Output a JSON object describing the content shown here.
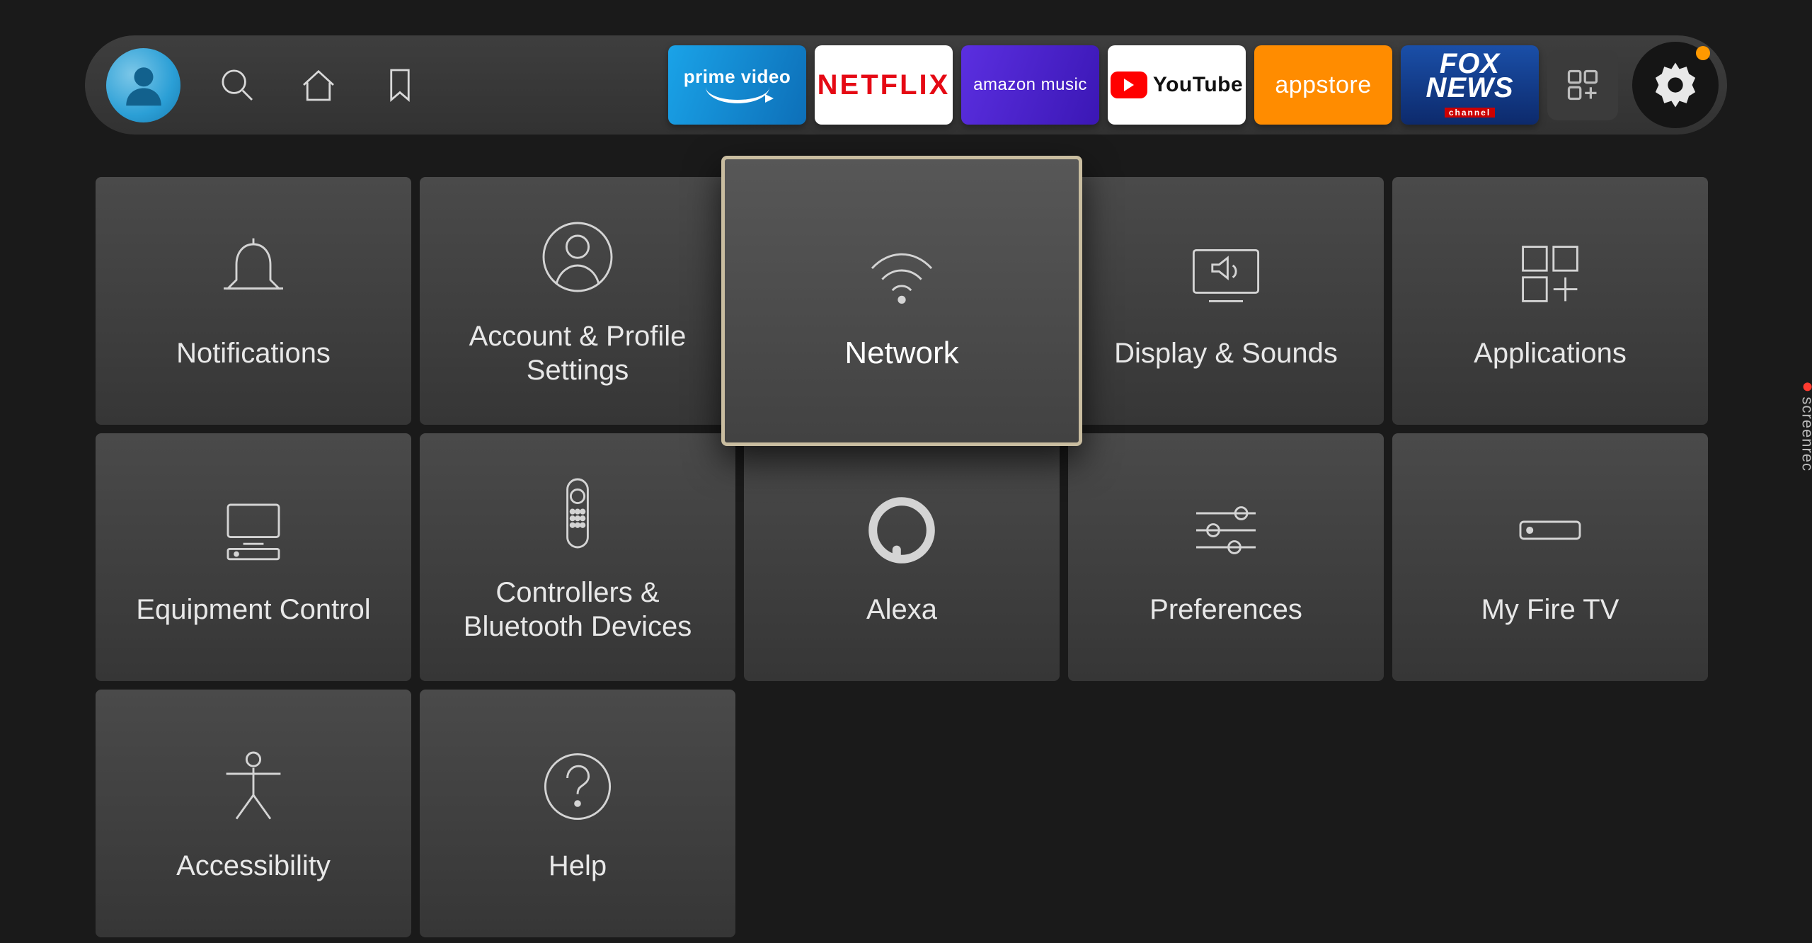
{
  "top_nav": {
    "apps": [
      {
        "id": "prime-video",
        "label": "prime video"
      },
      {
        "id": "netflix",
        "label": "NETFLIX"
      },
      {
        "id": "amazon-music",
        "label": "amazon music"
      },
      {
        "id": "youtube",
        "label": "YouTube"
      },
      {
        "id": "appstore",
        "label": "appstore"
      },
      {
        "id": "fox-news",
        "label": "FOX NEWS channel"
      }
    ],
    "settings_has_notification": true
  },
  "settings": {
    "selected_index": 2,
    "tiles": [
      {
        "id": "notifications",
        "label": "Notifications",
        "icon": "bell-icon"
      },
      {
        "id": "account-profile",
        "label": "Account & Profile Settings",
        "icon": "person-circle-icon"
      },
      {
        "id": "network",
        "label": "Network",
        "icon": "wifi-icon"
      },
      {
        "id": "display-sounds",
        "label": "Display & Sounds",
        "icon": "tv-sound-icon"
      },
      {
        "id": "applications",
        "label": "Applications",
        "icon": "apps-grid-icon"
      },
      {
        "id": "equipment-control",
        "label": "Equipment Control",
        "icon": "equipment-icon"
      },
      {
        "id": "controllers-bt",
        "label": "Controllers & Bluetooth Devices",
        "icon": "remote-icon"
      },
      {
        "id": "alexa",
        "label": "Alexa",
        "icon": "alexa-icon"
      },
      {
        "id": "preferences",
        "label": "Preferences",
        "icon": "sliders-icon"
      },
      {
        "id": "my-fire-tv",
        "label": "My Fire TV",
        "icon": "firetv-icon"
      },
      {
        "id": "accessibility",
        "label": "Accessibility",
        "icon": "accessibility-icon"
      },
      {
        "id": "help",
        "label": "Help",
        "icon": "help-icon"
      }
    ]
  },
  "watermark": "screenrec",
  "colors": {
    "accent_orange": "#ff9900",
    "selection_border": "#c9bda0",
    "netflix_red": "#e50914",
    "youtube_red": "#ff0000",
    "appstore_orange": "#ff8c00",
    "prime_blue": "#1aa3e8",
    "music_purple": "#5b2fe0",
    "fox_blue": "#1a4fa8"
  }
}
